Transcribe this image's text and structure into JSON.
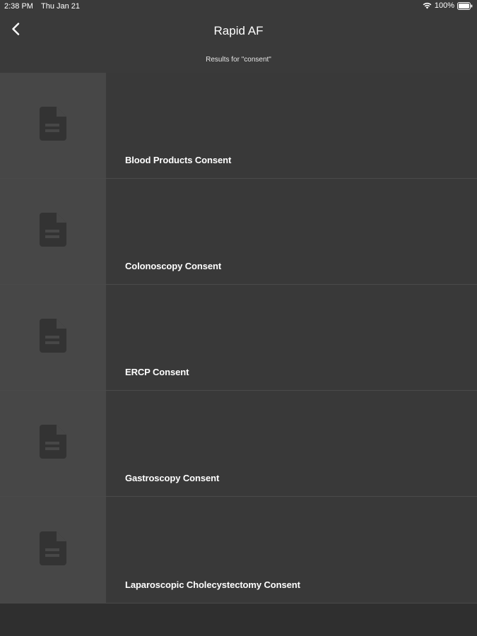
{
  "status_bar": {
    "time": "2:38 PM",
    "date": "Thu Jan 21",
    "battery": "100%"
  },
  "nav": {
    "title": "Rapid AF",
    "subtitle": "Results for \"consent\""
  },
  "results": [
    {
      "label": "Blood Products Consent",
      "icon": "document-icon"
    },
    {
      "label": "Colonoscopy Consent",
      "icon": "document-icon"
    },
    {
      "label": "ERCP Consent",
      "icon": "document-icon"
    },
    {
      "label": "Gastroscopy Consent",
      "icon": "document-icon"
    },
    {
      "label": "Laparoscopic Cholecystectomy Consent",
      "icon": "document-icon"
    }
  ],
  "colors": {
    "background": "#2f2f2f",
    "header": "#3a3a3a",
    "row": "#393939",
    "thumbnail": "#474747",
    "icon": "#333333"
  }
}
